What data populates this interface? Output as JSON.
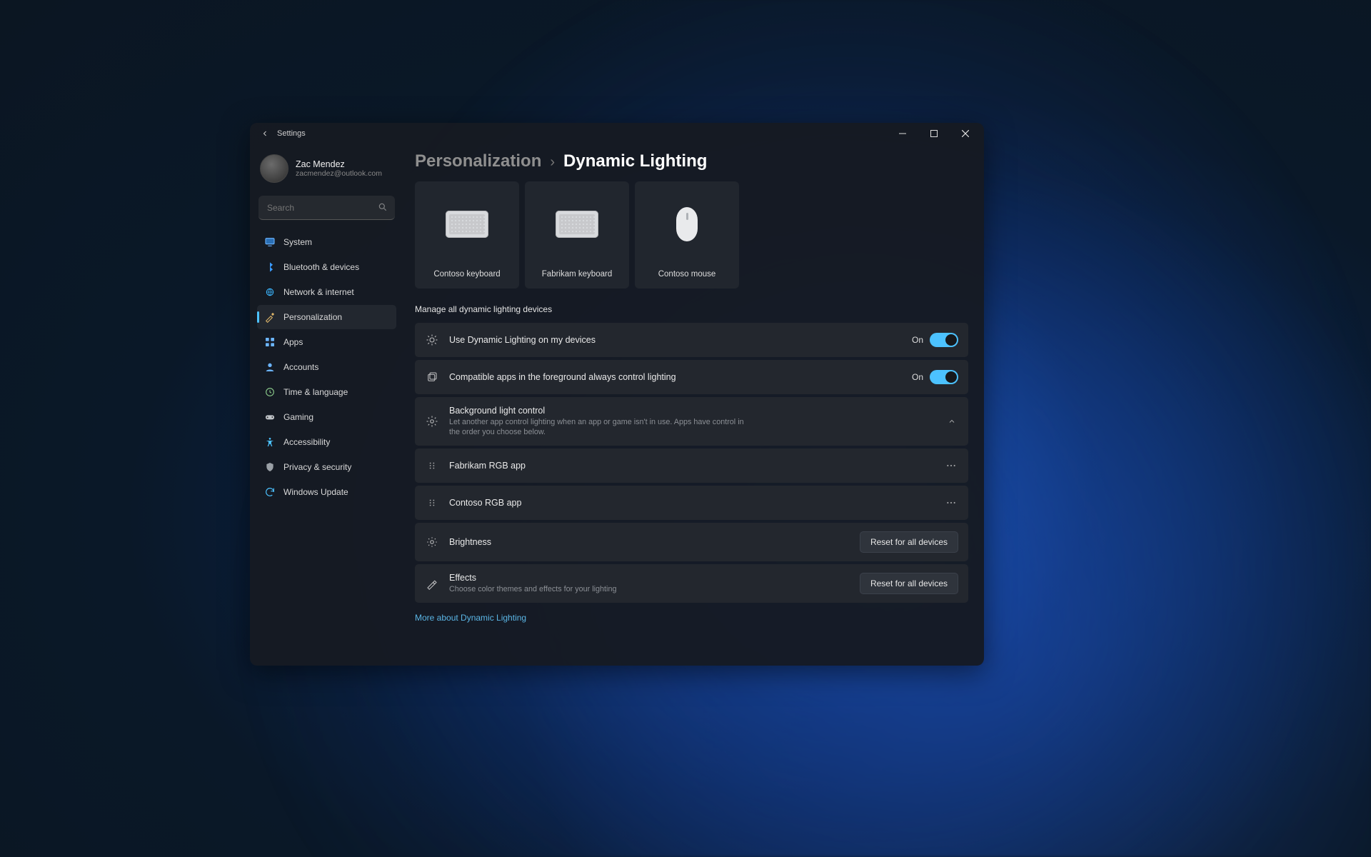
{
  "app": {
    "title": "Settings"
  },
  "titlebar": {
    "min": "min",
    "max": "max",
    "close": "close"
  },
  "user": {
    "name": "Zac Mendez",
    "email": "zacmendez@outlook.com"
  },
  "search": {
    "placeholder": "Search"
  },
  "sidebar": {
    "items": [
      {
        "id": "system",
        "label": "System"
      },
      {
        "id": "bluetooth",
        "label": "Bluetooth & devices"
      },
      {
        "id": "network",
        "label": "Network & internet"
      },
      {
        "id": "personalization",
        "label": "Personalization"
      },
      {
        "id": "apps",
        "label": "Apps"
      },
      {
        "id": "accounts",
        "label": "Accounts"
      },
      {
        "id": "time",
        "label": "Time & language"
      },
      {
        "id": "gaming",
        "label": "Gaming"
      },
      {
        "id": "accessibility",
        "label": "Accessibility"
      },
      {
        "id": "privacy",
        "label": "Privacy & security"
      },
      {
        "id": "update",
        "label": "Windows Update"
      }
    ],
    "active_index": 3
  },
  "breadcrumb": {
    "parent": "Personalization",
    "current": "Dynamic Lighting"
  },
  "devices": [
    {
      "label": "Contoso keyboard",
      "kind": "keyboard"
    },
    {
      "label": "Fabrikam keyboard",
      "kind": "keyboard"
    },
    {
      "label": "Contoso mouse",
      "kind": "mouse"
    }
  ],
  "section_title": "Manage all dynamic lighting devices",
  "settings": {
    "use_dynamic": {
      "title": "Use Dynamic Lighting on my devices",
      "state": "On",
      "on": true
    },
    "compatible_apps": {
      "title": "Compatible apps in the foreground always control lighting",
      "state": "On",
      "on": true
    },
    "background": {
      "title": "Background light control",
      "desc": "Let another app control lighting when an app or game isn't in use. Apps have control in the order you choose below."
    },
    "bg_apps": [
      {
        "name": "Fabrikam RGB app"
      },
      {
        "name": "Contoso RGB app"
      }
    ],
    "brightness": {
      "title": "Brightness",
      "button": "Reset for all devices"
    },
    "effects": {
      "title": "Effects",
      "desc": "Choose color themes and effects for your lighting",
      "button": "Reset for all devices"
    }
  },
  "footer_link": "More about Dynamic Lighting",
  "icons": {
    "back_arrow": "←"
  }
}
